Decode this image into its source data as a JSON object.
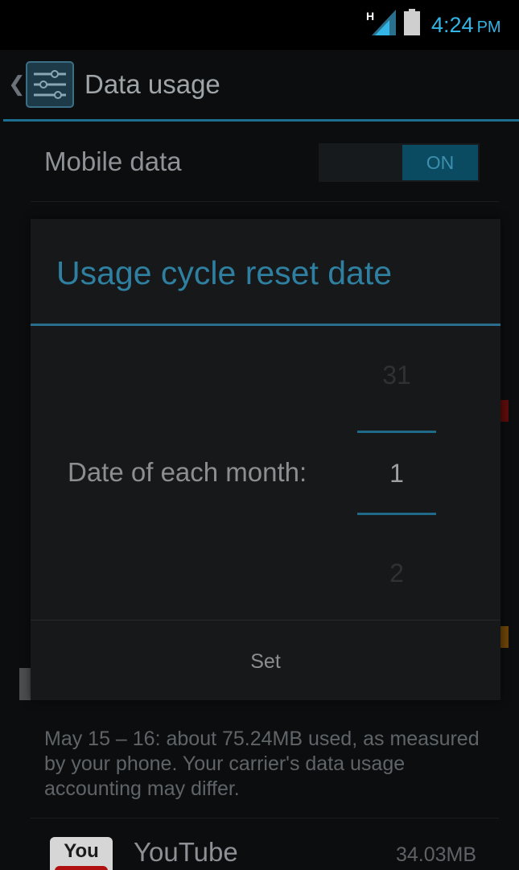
{
  "status_bar": {
    "network_type": "H",
    "time": "4:24",
    "ampm": "PM",
    "accent_color": "#33b5e5",
    "icons": [
      "signal-icon",
      "battery-icon"
    ]
  },
  "action_bar": {
    "title": "Data usage",
    "up_icon": "chevron-left-icon",
    "app_icon": "settings-sliders-icon"
  },
  "mobile_data": {
    "label": "Mobile data",
    "toggle_label": "ON"
  },
  "dialog": {
    "title": "Usage cycle reset date",
    "label": "Date of each month:",
    "picker": {
      "previous": "31",
      "current": "1",
      "next": "2"
    },
    "set_button": "Set"
  },
  "usage_note": "May 15 – 16: about 75.24MB used, as measured by your phone. Your carrier's data usage accounting may differ.",
  "apps": [
    {
      "icon_text": "You",
      "name": "YouTube",
      "size": "34.03MB"
    }
  ]
}
